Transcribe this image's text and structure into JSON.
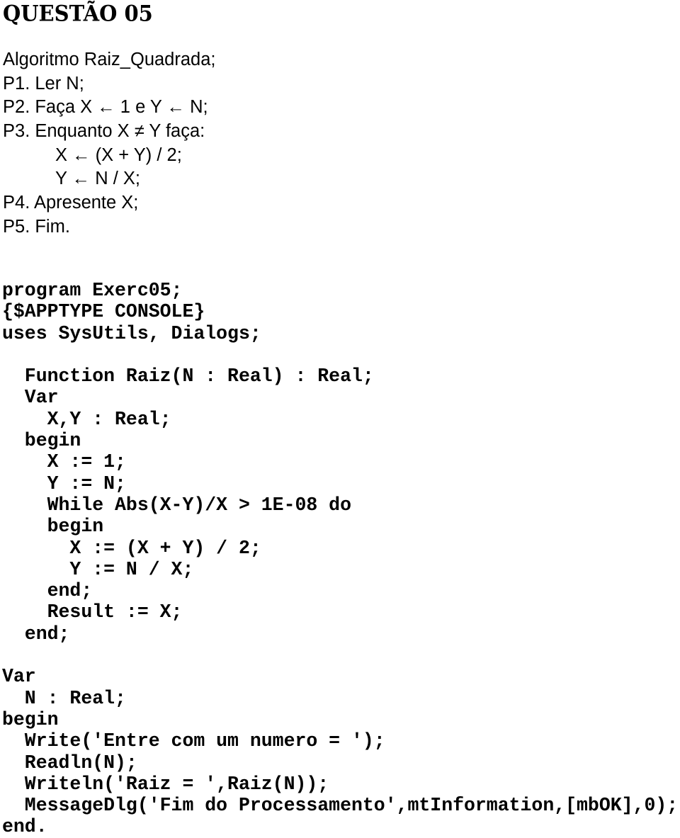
{
  "title": "QUESTÃO 05",
  "algorithm": {
    "lines": [
      {
        "text": "Algoritmo Raiz_Quadrada;",
        "indent": false
      },
      {
        "text": "P1. Ler N;",
        "indent": false
      },
      {
        "text": "P2. Faça X ← 1 e Y ← N;",
        "indent": false
      },
      {
        "text": "P3. Enquanto X ≠ Y faça:",
        "indent": false
      },
      {
        "text": "X ← (X + Y) / 2;",
        "indent": true
      },
      {
        "text": "Y ← N / X;",
        "indent": true
      },
      {
        "text": "P4. Apresente X;",
        "indent": false
      },
      {
        "text": "P5. Fim.",
        "indent": false
      }
    ]
  },
  "code": {
    "lines": [
      "program Exerc05;",
      "{$APPTYPE CONSOLE}",
      "uses SysUtils, Dialogs;",
      "",
      "  Function Raiz(N : Real) : Real;",
      "  Var",
      "    X,Y : Real;",
      "  begin",
      "    X := 1;",
      "    Y := N;",
      "    While Abs(X-Y)/X > 1E-08 do",
      "    begin",
      "      X := (X + Y) / 2;",
      "      Y := N / X;",
      "    end;",
      "    Result := X;",
      "  end;",
      "",
      "Var",
      "  N : Real;",
      "begin",
      "  Write('Entre com um numero = ');",
      "  Readln(N);",
      "  Writeln('Raiz = ',Raiz(N));",
      "  MessageDlg('Fim do Processamento',mtInformation,[mbOK],0);",
      "end."
    ]
  }
}
